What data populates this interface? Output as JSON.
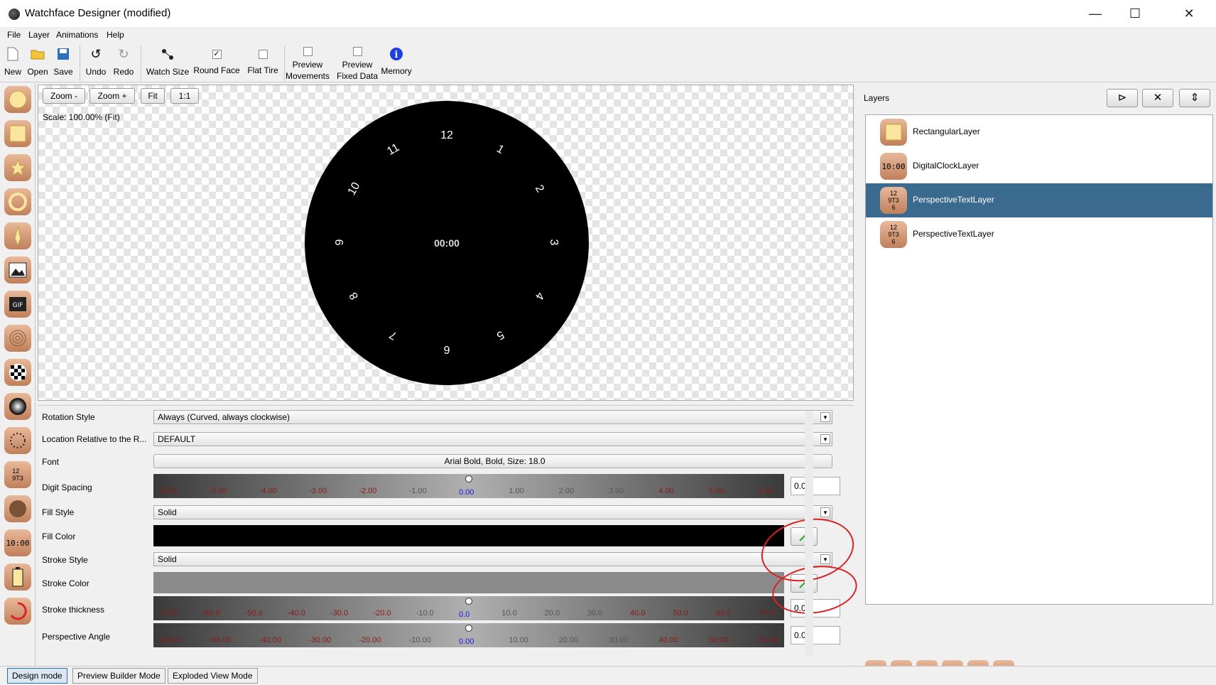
{
  "window": {
    "title": "Watchface Designer (modified)",
    "minimize": "—",
    "maximize": "☐",
    "close": "✕"
  },
  "menu": [
    "File",
    "Layer",
    "Animations",
    "Help"
  ],
  "toolbar": {
    "new": "New",
    "open": "Open",
    "save": "Save",
    "undo": "Undo",
    "redo": "Redo",
    "watch_size": "Watch Size",
    "round_face": "Round Face",
    "flat_tire": "Flat Tire",
    "preview_movements_1": "Preview",
    "preview_movements_2": "Movements",
    "preview_fixed_1": "Preview",
    "preview_fixed_2": "Fixed Data",
    "memory": "Memory",
    "round_face_checked": true
  },
  "canvas": {
    "zoom_out": "Zoom -",
    "zoom_in": "Zoom +",
    "fit": "Fit",
    "one_to_one": "1:1",
    "scale_text": "Scale: 100.00% (Fit)",
    "center_time": "00:00",
    "hours": [
      "12",
      "1",
      "2",
      "3",
      "4",
      "5",
      "6",
      "7",
      "8",
      "9",
      "10",
      "11"
    ]
  },
  "properties": {
    "rotation_style": {
      "label": "Rotation Style",
      "value": "Always (Curved, always clockwise)"
    },
    "location": {
      "label": "Location Relative to the R...",
      "value": "DEFAULT"
    },
    "font": {
      "label": "Font",
      "value": "Arial Bold, Bold, Size: 18.0"
    },
    "digit_spacing": {
      "label": "Digit Spacing",
      "value": "0.00",
      "ticks": [
        "-6.00",
        "-5.00",
        "-4.00",
        "-3.00",
        "-2.00",
        "-1.00",
        "0.00",
        "1.00",
        "2.00",
        "3.00",
        "4.00",
        "5.00",
        "6.00"
      ]
    },
    "fill_style": {
      "label": "Fill Style",
      "value": "Solid"
    },
    "fill_color": {
      "label": "Fill Color",
      "color": "#000000"
    },
    "stroke_style": {
      "label": "Stroke Style",
      "value": "Solid"
    },
    "stroke_color": {
      "label": "Stroke Color",
      "color": "#8a8a8a"
    },
    "stroke_thickness": {
      "label": "Stroke thickness",
      "value": "0.0",
      "ticks": [
        "-70.0",
        "-60.0",
        "-50.0",
        "-40.0",
        "-30.0",
        "-20.0",
        "-10.0",
        "0.0",
        "10.0",
        "20.0",
        "30.0",
        "40.0",
        "50.0",
        "60.0",
        "70.0"
      ]
    },
    "perspective_angle": {
      "label": "Perspective Angle",
      "value": "0.00",
      "ticks": [
        "-60.00",
        "-50.00",
        "-40.00",
        "-30.00",
        "-20.00",
        "-10.00",
        "0.00",
        "10.00",
        "20.00",
        "30.00",
        "40.00",
        "50.00",
        "60.00"
      ]
    }
  },
  "layers_panel": {
    "title": "Layers",
    "items": [
      {
        "name": "RectangularLayer",
        "icon": "rect-icon"
      },
      {
        "name": "DigitalClockLayer",
        "icon": "digital-clock-icon",
        "glyph": "10:00"
      },
      {
        "name": "PerspectiveTextLayer",
        "icon": "perspective-text-icon",
        "selected": true
      },
      {
        "name": "PerspectiveTextLayer",
        "icon": "perspective-text-icon"
      }
    ]
  },
  "modes": [
    "Design mode",
    "Preview Builder Mode",
    "Exploded View Mode"
  ],
  "colors": {
    "selection": "#3b6a8f",
    "accent_red": "#e02020"
  }
}
